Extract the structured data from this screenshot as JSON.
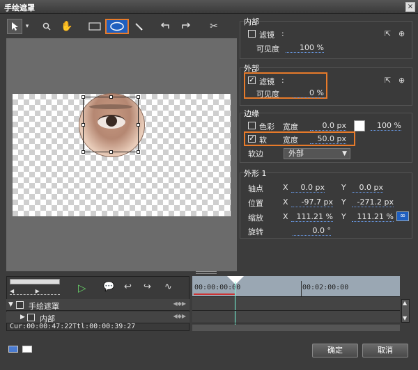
{
  "window": {
    "title": "手绘遮罩",
    "close_icon": "×"
  },
  "toolbar": {
    "tools": [
      "select-arrow-icon",
      "zoom-icon",
      "hand-icon",
      "rectangle-icon",
      "ellipse-icon",
      "pen-icon",
      "undo-icon",
      "redo-icon",
      "scissors-icon"
    ]
  },
  "inner": {
    "title": "内部",
    "filter_label": "滤镜",
    "filter_colon": ":",
    "filter_checked": false,
    "visibility_label": "可见度",
    "visibility_value": "100 %"
  },
  "outer": {
    "title": "外部",
    "filter_label": "滤镜",
    "filter_colon": ":",
    "filter_checked": true,
    "visibility_label": "可见度",
    "visibility_value": "0 %"
  },
  "edge": {
    "title": "边缘",
    "color_label": "色彩",
    "color_checked": false,
    "width_label": "宽度",
    "color_width_value": "0.0 px",
    "color_percent": "100 %",
    "soft_label": "软",
    "soft_checked": true,
    "soft_width_label": "宽度",
    "soft_width_value": "50.0 px",
    "soft_edge_label": "软边",
    "soft_edge_option": "外部"
  },
  "shape": {
    "title": "外形 1",
    "anchor_label": "轴点",
    "anchor_x_label": "X",
    "anchor_x": "0.0 px",
    "anchor_y_label": "Y",
    "anchor_y": "0.0 px",
    "position_label": "位置",
    "position_x_label": "X",
    "position_x": "-97.7 px",
    "position_y_label": "Y",
    "position_y": "-271.2 px",
    "scale_label": "缩放",
    "scale_x_label": "X",
    "scale_x": "111.21 %",
    "scale_y_label": "Y",
    "scale_y": "111.21 %",
    "rotate_label": "旋转",
    "rotate_value": "0.0 °"
  },
  "timeline": {
    "ruler_start": "00:00:00:00",
    "ruler_mark": "00:02:00:00",
    "track1_label": "手绘遮罩",
    "track2_label": "内部",
    "cur_label": "Cur:00:00:47:22",
    "ttl_label": "Ttl:00:00:39:27"
  },
  "footer": {
    "ok_label": "确定",
    "cancel_label": "取消"
  },
  "colors": {
    "accent_orange": "#e87b2a",
    "selected_blue": "#1f5fbf"
  }
}
